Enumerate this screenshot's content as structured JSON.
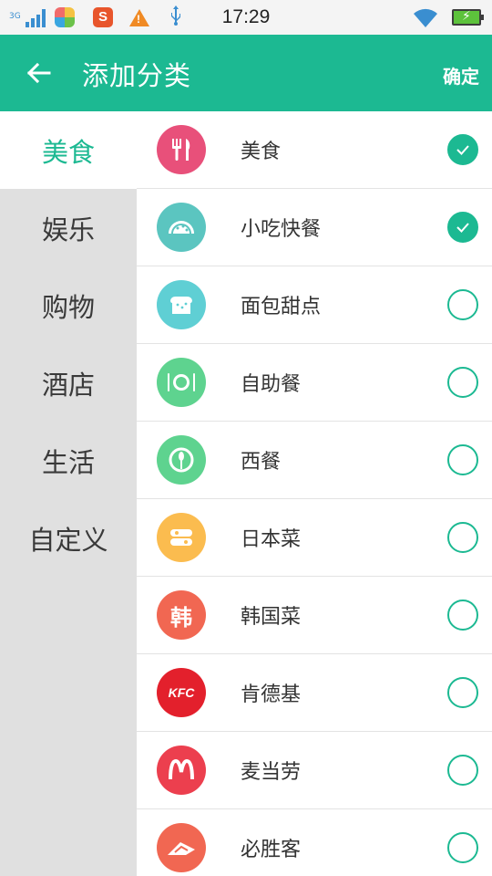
{
  "status_bar": {
    "network": "3G",
    "time": "17:29"
  },
  "header": {
    "title": "添加分类",
    "confirm_label": "确定"
  },
  "sidebar": {
    "items": [
      {
        "label": "美食",
        "active": true
      },
      {
        "label": "娱乐",
        "active": false
      },
      {
        "label": "购物",
        "active": false
      },
      {
        "label": "酒店",
        "active": false
      },
      {
        "label": "生活",
        "active": false
      },
      {
        "label": "自定义",
        "active": false
      }
    ]
  },
  "list": {
    "items": [
      {
        "label": "美食",
        "icon": "fork-knife-icon",
        "color": "#e8507a",
        "checked": true
      },
      {
        "label": "小吃快餐",
        "icon": "taco-icon",
        "color": "#5bc5c0",
        "checked": true
      },
      {
        "label": "面包甜点",
        "icon": "bread-icon",
        "color": "#5fcfd4",
        "checked": false
      },
      {
        "label": "自助餐",
        "icon": "plate-icon",
        "color": "#5ed38f",
        "checked": false
      },
      {
        "label": "西餐",
        "icon": "western-food-icon",
        "color": "#5ed38f",
        "checked": false
      },
      {
        "label": "日本菜",
        "icon": "sushi-icon",
        "color": "#fbbc4f",
        "checked": false
      },
      {
        "label": "韩国菜",
        "icon": "korean-food-icon",
        "icon_text": "韩",
        "color": "#f16752",
        "checked": false
      },
      {
        "label": "肯德基",
        "icon": "kfc-icon",
        "icon_text": "KFC",
        "color": "#e3202c",
        "checked": false
      },
      {
        "label": "麦当劳",
        "icon": "mcdonalds-icon",
        "color": "#ec3f4e",
        "checked": false
      },
      {
        "label": "必胜客",
        "icon": "pizza-hut-icon",
        "color": "#f16752",
        "checked": false
      }
    ]
  },
  "colors": {
    "accent": "#1cb992",
    "sidebar_bg": "#e0e0e0"
  }
}
